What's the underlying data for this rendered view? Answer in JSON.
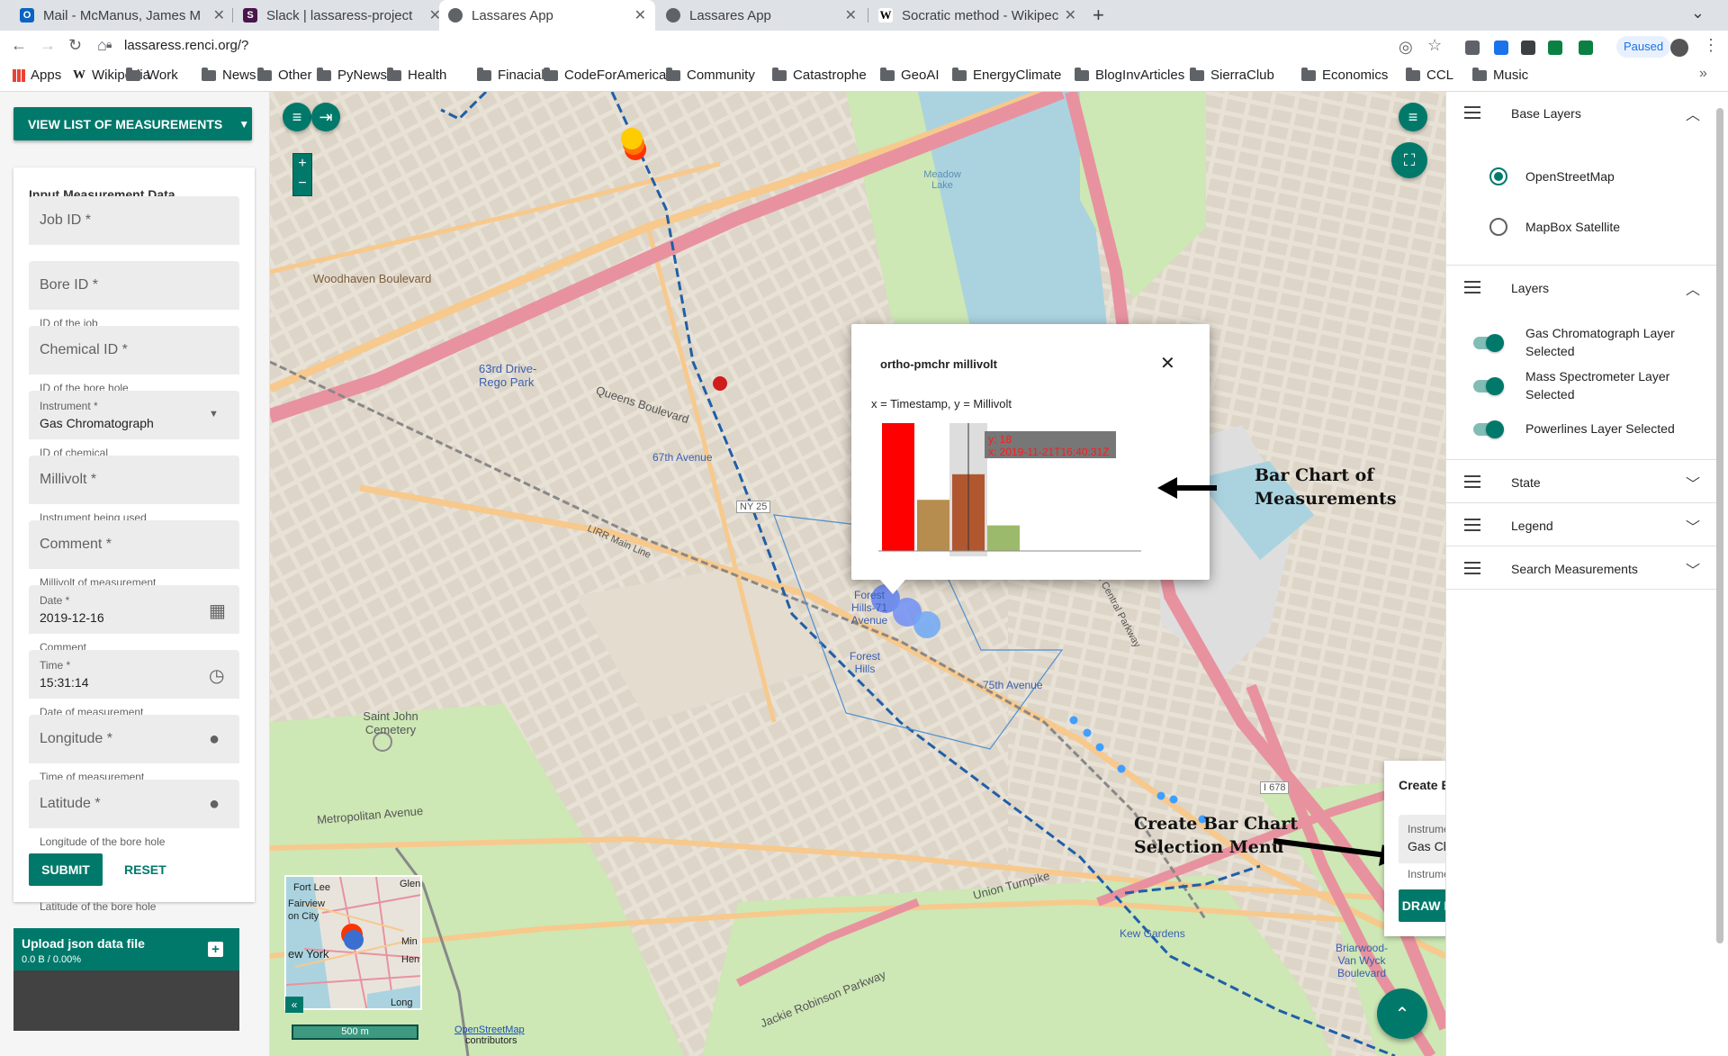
{
  "browser": {
    "tabs": [
      {
        "label": "Mail - McManus, James M",
        "favicon_color": "#0a64c2",
        "favicon_text": "O"
      },
      {
        "label": "Slack | lassaress-project",
        "favicon_color": "#4a154b",
        "favicon_text": "S"
      },
      {
        "label": "Lassares App",
        "favicon_color": "#5f6368",
        "favicon_text": ""
      },
      {
        "label": "Lassares App",
        "favicon_color": "#5f6368",
        "favicon_text": ""
      },
      {
        "label": "Socratic method - Wikipec",
        "favicon_color": "#ffffff",
        "favicon_text": "W"
      }
    ],
    "url": "lassaress.renci.org/?",
    "profile_status": "Paused",
    "bookmarks": [
      "Apps",
      "Wikipedia",
      "Work",
      "News",
      "Other",
      "PyNews",
      "Health",
      "Finacial",
      "CodeForAmerica",
      "Community",
      "Catastrophe",
      "GeoAI",
      "EnergyClimate",
      "BlogInvArticles",
      "SierraClub",
      "Economics",
      "CCL",
      "Music"
    ]
  },
  "left_panel": {
    "view_list_label": "VIEW LIST OF MEASUREMENTS",
    "form_title": "Input Measurement Data",
    "fields": {
      "job_id": {
        "label": "Job ID *",
        "hint": "ID of the job"
      },
      "bore_id": {
        "label": "Bore ID *",
        "hint": "ID of the bore hole"
      },
      "chemical_id": {
        "label": "Chemical ID *",
        "hint": "ID of chemical"
      },
      "instrument": {
        "label": "Instrument *",
        "value": "Gas Chromatograph",
        "hint": "Instrument being used"
      },
      "millivolt": {
        "label": "Millivolt *",
        "hint": "Millivolt of measurement"
      },
      "comment": {
        "label": "Comment *",
        "hint": "Comment"
      },
      "date": {
        "label": "Date *",
        "value": "2019-12-16",
        "hint": "Date of measurement"
      },
      "time": {
        "label": "Time *",
        "value": "15:31:14",
        "hint": "Time of measurement"
      },
      "longitude": {
        "label": "Longitude *",
        "hint": "Longitude of the bore hole"
      },
      "latitude": {
        "label": "Latitude *",
        "hint": "Latitude of the bore hole"
      }
    },
    "submit_label": "SUBMIT",
    "reset_label": "RESET",
    "upload": {
      "title": "Upload json data file",
      "status": "0.0 B / 0.00%"
    }
  },
  "map": {
    "labels": {
      "woodhaven": "Woodhaven Boulevard",
      "rego_park": "63rd Drive-Rego Park",
      "queens_blvd": "Queens Boulevard",
      "ave67": "67th Avenue",
      "ny25": "NY 25",
      "forest_hills_71": "Forest Hills-71 Avenue",
      "forest_hills": "Forest Hills",
      "ave75": "75th Avenue",
      "saint_john": "Saint John Cemetery",
      "metropolitan": "Metropolitan Avenue",
      "union_tpke": "Union Turnpike",
      "kew_gardens": "Kew Gardens",
      "briarwood": "Briarwood-Van Wyck Boulevard",
      "meadow_lake": "Meadow Lake",
      "grand_central": "Grand Central Parkway",
      "i678": "I 678",
      "jackie_robinson": "Jackie Robinson Parkway",
      "lirr": "LIRR Main Line"
    },
    "scale_label": "500 m",
    "attribution_link": "OpenStreetMap",
    "attribution_rest": "contributors",
    "minimap_labels": [
      "Fort Lee",
      "Fairview",
      "on City",
      "ew York",
      "Glen",
      "Min",
      "Hen",
      "Long B"
    ]
  },
  "popup": {
    "title": "ortho-pmchr millivolt",
    "caption": "x = Timestamp, y = Millivolt",
    "tooltip_y": "y: 18",
    "tooltip_x": "x: 2019-11-21T16:40:31Z"
  },
  "chart_data": {
    "type": "bar",
    "title": "ortho-pmchr millivolt",
    "xlabel": "Timestamp",
    "ylabel": "Millivolt",
    "values": [
      30,
      12,
      18,
      6
    ],
    "colors": [
      "#ff0000",
      "#b78d4f",
      "#b0572f",
      "#9cba6b"
    ],
    "highlighted_index": 2,
    "highlighted_x": "2019-11-21T16:40:31Z",
    "ylim": [
      0,
      30
    ]
  },
  "annotations": {
    "bar_chart": [
      "Bar Chart of",
      "Measurements"
    ],
    "selection_menu": [
      "Create Bar Chart",
      "Selection Menu"
    ]
  },
  "bar_plot_card": {
    "title": "Create Bar Plot of Selected Features",
    "instrument_label": "Instrument *",
    "instrument_value": "Gas Chromatograph",
    "instrument_hint": "Instrument being used",
    "draw_label": "DRAW POLYGON AROUND FEATURES"
  },
  "right_panel": {
    "base_layers": {
      "title": "Base Layers",
      "options": [
        "OpenStreetMap",
        "MapBox Satellite"
      ],
      "selected": "OpenStreetMap"
    },
    "layers": {
      "title": "Layers",
      "toggles": [
        "Gas Chromatograph Layer Selected",
        "Mass Spectrometer Layer Selected",
        "Powerlines Layer Selected"
      ]
    },
    "state": "State",
    "legend": "Legend",
    "search": "Search Measurements"
  },
  "colors": {
    "accent": "#00796b",
    "highway": "#e8929f",
    "arterial": "#f7c98d",
    "park": "#cde7b5",
    "water": "#aad3df"
  }
}
